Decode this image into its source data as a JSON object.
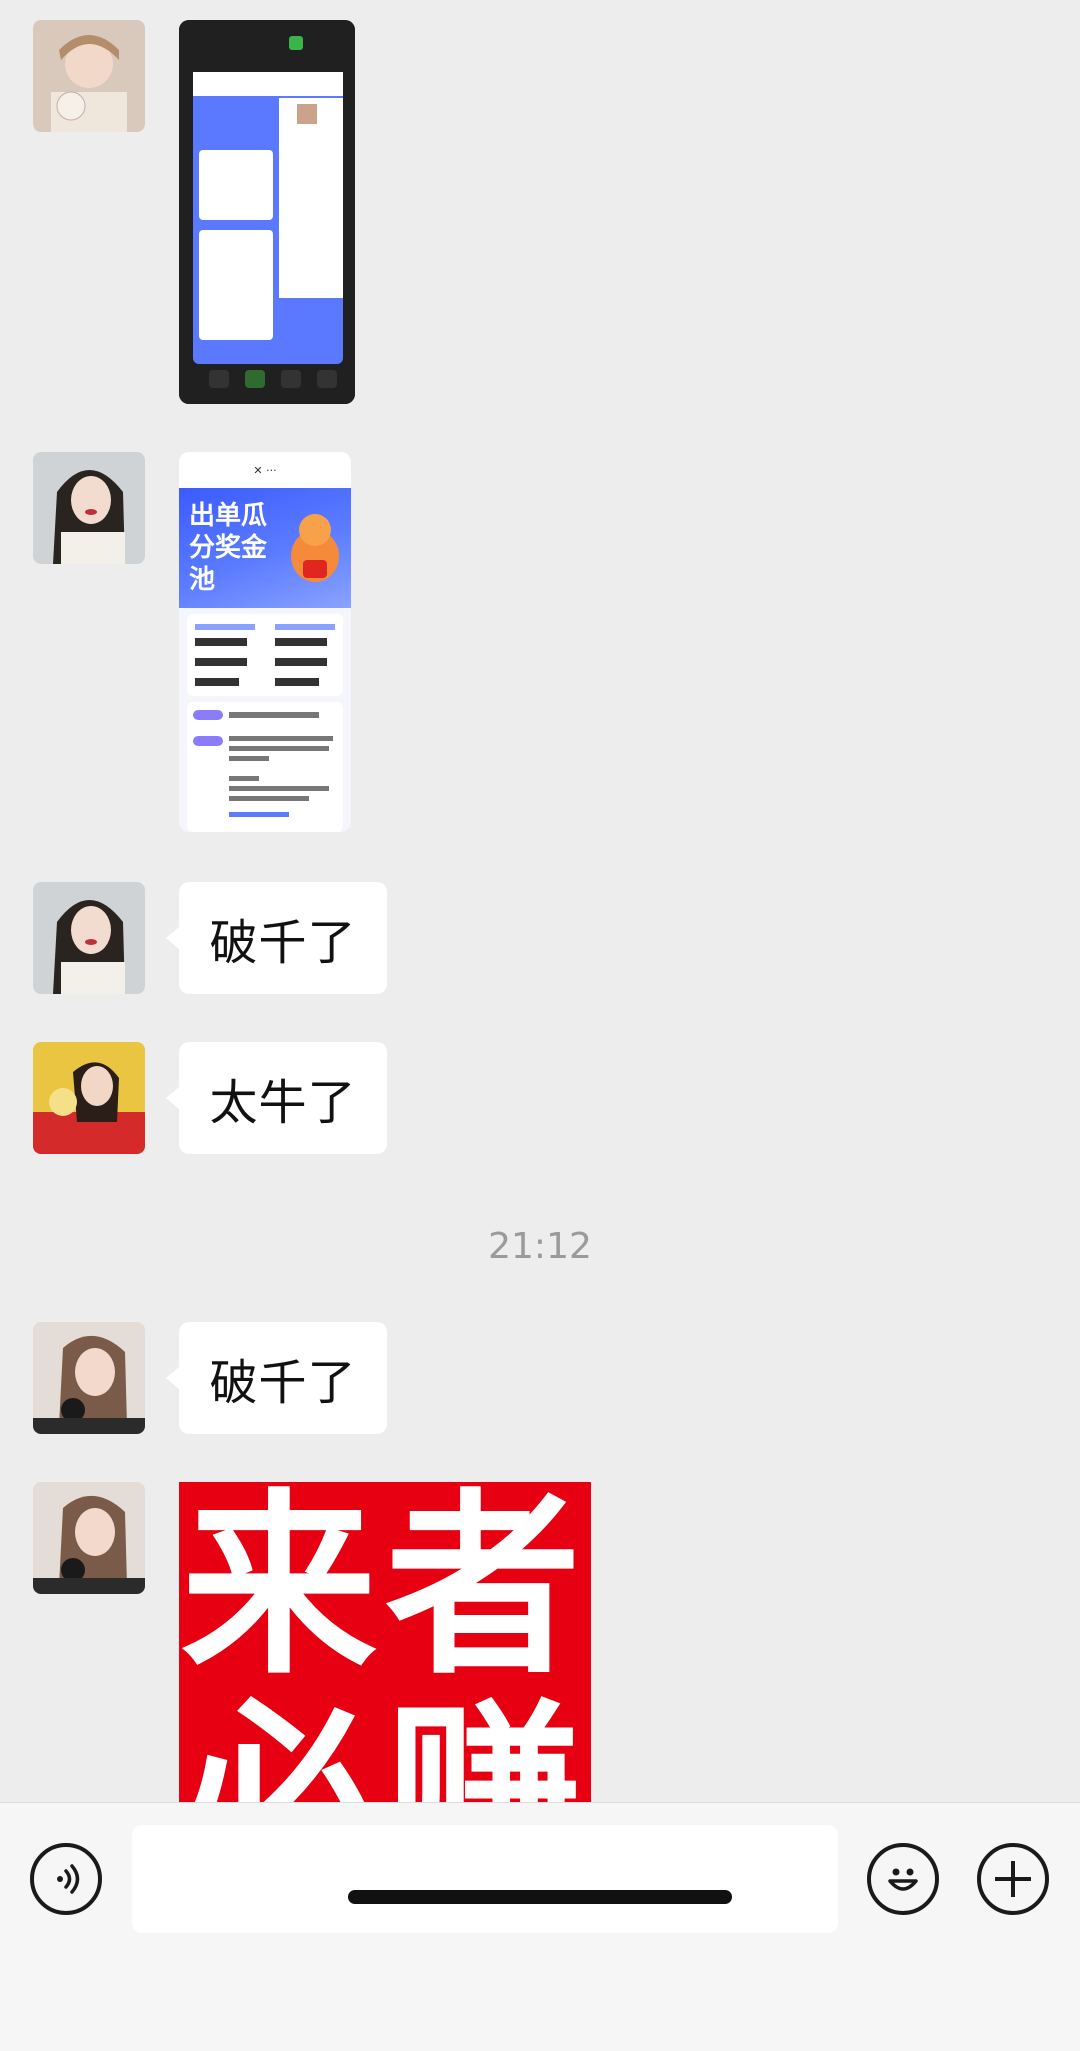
{
  "chat": {
    "messages": [
      {
        "type": "image",
        "desc_label": ""
      },
      {
        "type": "image",
        "banner_text": "出单瓜分奖金池"
      },
      {
        "type": "text",
        "text": "破千了"
      },
      {
        "type": "text",
        "text": "太牛了"
      },
      {
        "type": "text",
        "text": "破千了"
      },
      {
        "type": "sticker",
        "line1": "来者",
        "line2": "必赚"
      }
    ],
    "timestamp": "21:12"
  },
  "input_bar": {
    "placeholder": "",
    "voice_icon": "voice-icon",
    "emoji_icon": "emoji-icon",
    "plus_icon": "plus-icon"
  },
  "colors": {
    "background": "#ededed",
    "bubble": "#ffffff",
    "sticker_red": "#e60012",
    "timestamp": "#9a9a9a"
  }
}
